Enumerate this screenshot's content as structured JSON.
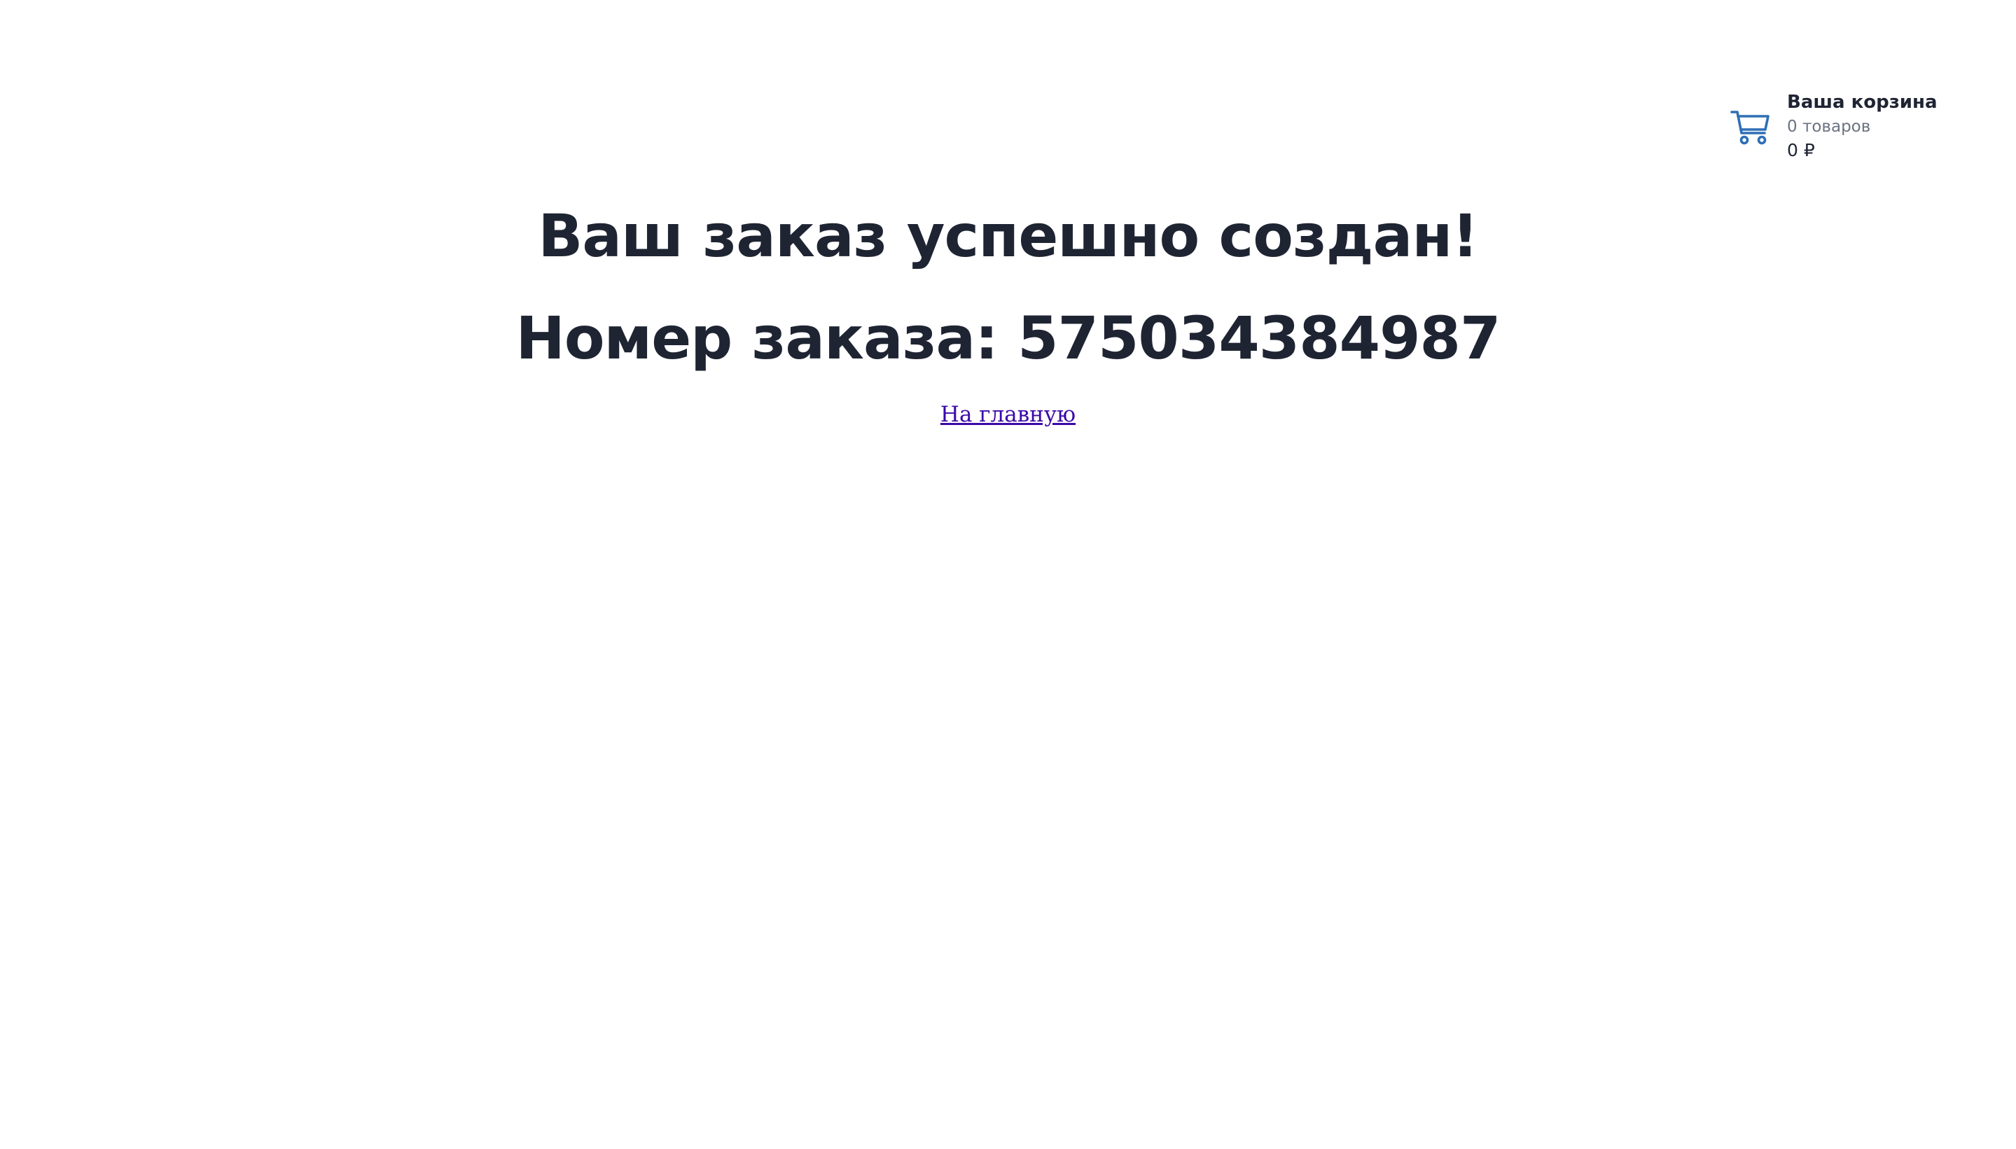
{
  "cart": {
    "icon": "shopping-cart-icon",
    "icon_color": "#2f6fb5",
    "title": "Ваша корзина",
    "count": "0 товаров",
    "total": "0 ₽"
  },
  "main": {
    "title": "Ваш заказ успешно создан!",
    "order_label": "Номер заказа:",
    "order_number": "575034384987",
    "home_link": "На главную"
  }
}
